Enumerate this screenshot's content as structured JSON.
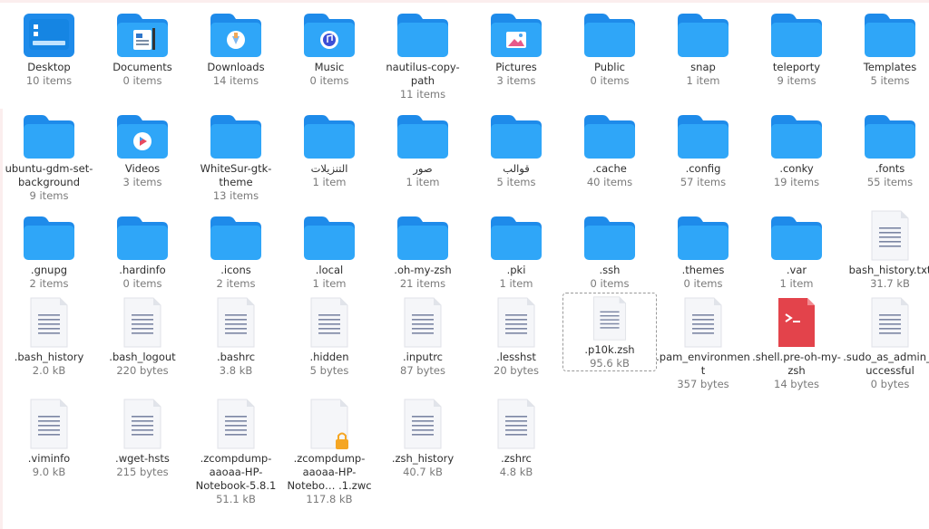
{
  "colors": {
    "folder_back": "#1e8bea",
    "folder_front": "#2fa6f8",
    "script_red": "#e3434b",
    "lock": "#f5a623"
  },
  "rows": [
    [
      {
        "name": "Desktop",
        "meta": "10 items",
        "kind": "folder",
        "emblem": "desktop"
      },
      {
        "name": "Documents",
        "meta": "0 items",
        "kind": "folder",
        "emblem": "documents"
      },
      {
        "name": "Downloads",
        "meta": "14 items",
        "kind": "folder",
        "emblem": "downloads"
      },
      {
        "name": "Music",
        "meta": "0 items",
        "kind": "folder",
        "emblem": "music"
      },
      {
        "name": "nautilus-copy-path",
        "meta": "11 items",
        "kind": "folder",
        "emblem": ""
      },
      {
        "name": "Pictures",
        "meta": "3 items",
        "kind": "folder",
        "emblem": "pictures"
      },
      {
        "name": "Public",
        "meta": "0 items",
        "kind": "folder",
        "emblem": ""
      },
      {
        "name": "snap",
        "meta": "1 item",
        "kind": "folder",
        "emblem": ""
      },
      {
        "name": "teleporty",
        "meta": "9 items",
        "kind": "folder",
        "emblem": ""
      },
      {
        "name": "Templates",
        "meta": "5 items",
        "kind": "folder",
        "emblem": ""
      }
    ],
    [
      {
        "name": "ubuntu-gdm-set-background",
        "meta": "9 items",
        "kind": "folder",
        "emblem": ""
      },
      {
        "name": "Videos",
        "meta": "3 items",
        "kind": "folder",
        "emblem": "videos"
      },
      {
        "name": "WhiteSur-gtk-theme",
        "meta": "13 items",
        "kind": "folder",
        "emblem": ""
      },
      {
        "name": "التنزيلات",
        "meta": "1 item",
        "kind": "folder",
        "emblem": ""
      },
      {
        "name": "صور",
        "meta": "1 item",
        "kind": "folder",
        "emblem": ""
      },
      {
        "name": "قوالب",
        "meta": "5 items",
        "kind": "folder",
        "emblem": ""
      },
      {
        "name": ".cache",
        "meta": "40 items",
        "kind": "folder",
        "emblem": ""
      },
      {
        "name": ".config",
        "meta": "57 items",
        "kind": "folder",
        "emblem": ""
      },
      {
        "name": ".conky",
        "meta": "19 items",
        "kind": "folder",
        "emblem": ""
      },
      {
        "name": ".fonts",
        "meta": "55 items",
        "kind": "folder",
        "emblem": ""
      }
    ],
    [
      {
        "name": ".gnupg",
        "meta": "2 items",
        "kind": "folder",
        "emblem": ""
      },
      {
        "name": ".hardinfo",
        "meta": "0 items",
        "kind": "folder",
        "emblem": ""
      },
      {
        "name": ".icons",
        "meta": "2 items",
        "kind": "folder",
        "emblem": ""
      },
      {
        "name": ".local",
        "meta": "1 item",
        "kind": "folder",
        "emblem": ""
      },
      {
        "name": ".oh-my-zsh",
        "meta": "21 items",
        "kind": "folder",
        "emblem": ""
      },
      {
        "name": ".pki",
        "meta": "1 item",
        "kind": "folder",
        "emblem": ""
      },
      {
        "name": ".ssh",
        "meta": "0 items",
        "kind": "folder",
        "emblem": ""
      },
      {
        "name": ".themes",
        "meta": "0 items",
        "kind": "folder",
        "emblem": ""
      },
      {
        "name": ".var",
        "meta": "1 item",
        "kind": "folder",
        "emblem": ""
      },
      {
        "name": "bash_history.txt",
        "meta": "31.7 kB",
        "kind": "text",
        "emblem": ""
      }
    ],
    [
      {
        "name": ".bash_history",
        "meta": "2.0 kB",
        "kind": "text",
        "emblem": ""
      },
      {
        "name": ".bash_logout",
        "meta": "220 bytes",
        "kind": "text",
        "emblem": ""
      },
      {
        "name": ".bashrc",
        "meta": "3.8 kB",
        "kind": "text",
        "emblem": ""
      },
      {
        "name": ".hidden",
        "meta": "5 bytes",
        "kind": "text",
        "emblem": ""
      },
      {
        "name": ".inputrc",
        "meta": "87 bytes",
        "kind": "text",
        "emblem": ""
      },
      {
        "name": ".lesshst",
        "meta": "20 bytes",
        "kind": "text",
        "emblem": ""
      },
      {
        "name": ".p10k.zsh",
        "meta": "95.6 kB",
        "kind": "text",
        "emblem": "",
        "selected": true
      },
      {
        "name": ".pam_environment",
        "meta": "357 bytes",
        "kind": "text",
        "emblem": ""
      },
      {
        "name": ".shell.pre-oh-my-zsh",
        "meta": "14 bytes",
        "kind": "script",
        "emblem": ""
      },
      {
        "name": ".sudo_as_admin_successful",
        "meta": "0 bytes",
        "kind": "text",
        "emblem": ""
      }
    ],
    [
      {
        "name": ".viminfo",
        "meta": "9.0 kB",
        "kind": "text",
        "emblem": ""
      },
      {
        "name": ".wget-hsts",
        "meta": "215 bytes",
        "kind": "text",
        "emblem": ""
      },
      {
        "name": ".zcompdump-aaoaa-HP-Notebook-5.8.1",
        "meta": "51.1 kB",
        "kind": "text",
        "emblem": ""
      },
      {
        "name": ".zcompdump-aaoaa-HP-Notebo… .1.zwc",
        "meta": "117.8 kB",
        "kind": "locked",
        "emblem": ""
      },
      {
        "name": ".zsh_history",
        "meta": "40.7 kB",
        "kind": "text",
        "emblem": ""
      },
      {
        "name": ".zshrc",
        "meta": "4.8 kB",
        "kind": "text",
        "emblem": ""
      }
    ]
  ]
}
